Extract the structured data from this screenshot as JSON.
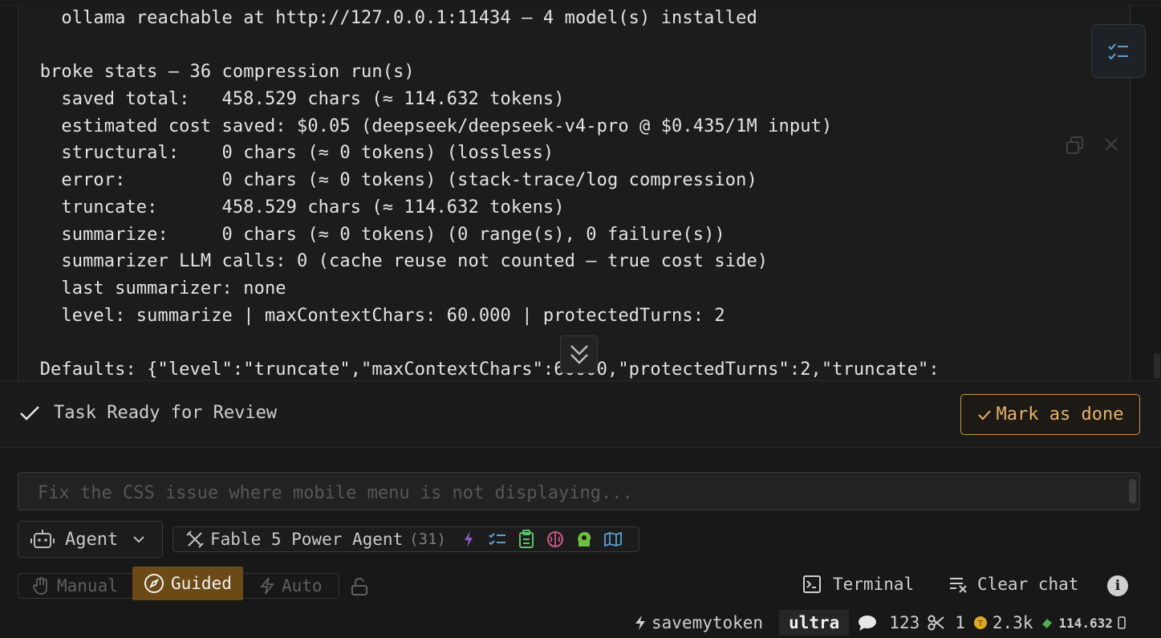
{
  "output": {
    "lines": [
      "    ollama reachable at http://127.0.0.1:11434 — 4 model(s) installed",
      "",
      "  broke stats — 36 compression run(s)",
      "    saved total:   458.529 chars (≈ 114.632 tokens)",
      "    estimated cost saved: $0.05 (deepseek/deepseek-v4-pro @ $0.435/1M input)",
      "    structural:    0 chars (≈ 0 tokens) (lossless)",
      "    error:         0 chars (≈ 0 tokens) (stack-trace/log compression)",
      "    truncate:      458.529 chars (≈ 114.632 tokens)",
      "    summarize:     0 chars (≈ 0 tokens) (0 range(s), 0 failure(s))",
      "    summarizer LLM calls: 0 (cache reuse not counted — true cost side)",
      "    last summarizer: none",
      "    level: summarize | maxContextChars: 60.000 | protectedTurns: 2",
      "",
      "  Defaults: {\"level\":\"truncate\",\"maxContextChars\":60000,\"protectedTurns\":2,\"truncate\":"
    ]
  },
  "task": {
    "status_label": "Task Ready for Review",
    "done_label": "Mark as done"
  },
  "input": {
    "placeholder": "Fix the CSS issue where mobile menu is not displaying..."
  },
  "agent": {
    "mode_label": "Agent",
    "name": "Fable 5 Power Agent",
    "tool_count": "(31)",
    "tool_icons": [
      "lightning-icon",
      "checklist-icon",
      "clipboard-icon",
      "brain-icon",
      "head-gear-icon",
      "map-icon"
    ]
  },
  "modes": {
    "manual": "Manual",
    "guided": "Guided",
    "auto": "Auto",
    "active": "Guided"
  },
  "actions": {
    "terminal": "Terminal",
    "clear_chat": "Clear chat"
  },
  "status": {
    "extension": "savemytoken",
    "level": "ultra",
    "messages": "123",
    "cuts": "1",
    "tokens": "2.3k",
    "saved": "114.632"
  },
  "colors": {
    "accent": "#c9954a",
    "accent_fill": "#6b4a16",
    "background": "#181818"
  }
}
